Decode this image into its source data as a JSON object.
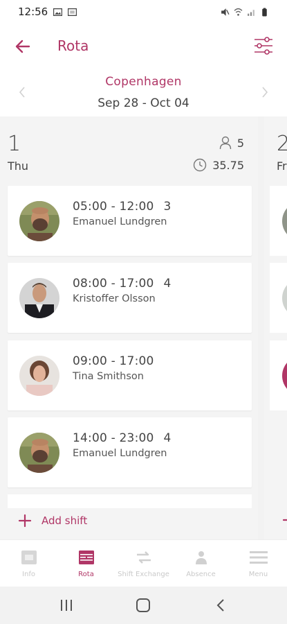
{
  "status_bar": {
    "time": "12:56"
  },
  "app_bar": {
    "title": "Rota"
  },
  "location": {
    "city": "Copenhagen",
    "date_range": "Sep 28 - Oct 04"
  },
  "day": {
    "number": "1",
    "name": "Thu",
    "people_count": "5",
    "hours": "35.75",
    "add_shift_label": "Add shift",
    "shifts": [
      {
        "time": "05:00 - 12:00",
        "badge": "3",
        "name": "Emanuel Lundgren"
      },
      {
        "time": "08:00 - 17:00",
        "badge": "4",
        "name": "Kristoffer Olsson"
      },
      {
        "time": "09:00 - 17:00",
        "badge": "",
        "name": "Tina Smithson"
      },
      {
        "time": "14:00 - 23:00",
        "badge": "4",
        "name": "Emanuel Lundgren"
      }
    ]
  },
  "next_day": {
    "number": "2",
    "name": "Fr"
  },
  "bottom_nav": {
    "items": [
      {
        "label": "Info"
      },
      {
        "label": "Rota"
      },
      {
        "label": "Shift Exchange"
      },
      {
        "label": "Absence"
      },
      {
        "label": "Menu"
      }
    ]
  },
  "colors": {
    "accent": "#b03666",
    "background": "#f4f4f4"
  },
  "icons": [
    "back-arrow-icon",
    "filter-sliders-icon",
    "chevron-left-icon",
    "chevron-right-icon",
    "person-icon",
    "clock-icon",
    "plus-icon"
  ]
}
